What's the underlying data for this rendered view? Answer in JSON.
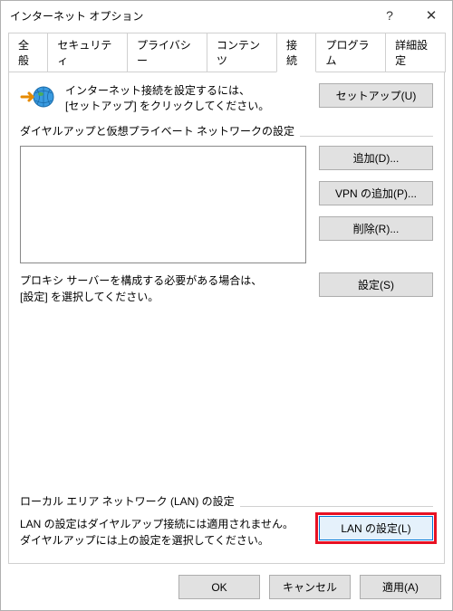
{
  "title": "インターネット オプション",
  "tabs": [
    "全般",
    "セキュリティ",
    "プライバシー",
    "コンテンツ",
    "接続",
    "プログラム",
    "詳細設定"
  ],
  "active_tab": "接続",
  "setup": {
    "line1": "インターネット接続を設定するには、",
    "line2": "[セットアップ] をクリックしてください。",
    "button": "セットアップ(U)"
  },
  "dialup": {
    "group_label": "ダイヤルアップと仮想プライベート ネットワークの設定",
    "buttons": {
      "add": "追加(D)...",
      "add_vpn": "VPN の追加(P)...",
      "remove": "削除(R)...",
      "settings": "設定(S)"
    },
    "proxy_line1": "プロキシ サーバーを構成する必要がある場合は、",
    "proxy_line2": "[設定] を選択してください。"
  },
  "lan": {
    "group_label": "ローカル エリア ネットワーク (LAN) の設定",
    "line1": "LAN の設定はダイヤルアップ接続には適用されません。",
    "line2": "ダイヤルアップには上の設定を選択してください。",
    "button": "LAN の設定(L)"
  },
  "footer": {
    "ok": "OK",
    "cancel": "キャンセル",
    "apply": "適用(A)"
  }
}
